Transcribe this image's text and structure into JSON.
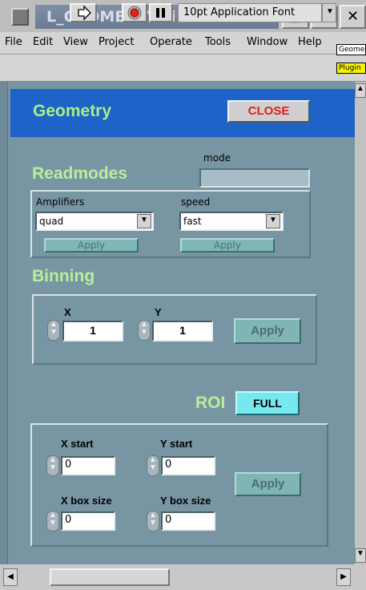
{
  "window": {
    "title": "L_GEOMETRY.vi Front Panel",
    "controls": {
      "minimize": "▣",
      "resize": "⇕",
      "close": "✕"
    }
  },
  "menu": [
    "File",
    "Edit",
    "View",
    "Project",
    "Operate",
    "Tools",
    "Window",
    "Help"
  ],
  "toolbar": {
    "font": "10pt Application Font",
    "side_tabs": [
      "Geome",
      "Plugin"
    ]
  },
  "panel": {
    "title": "Geometry",
    "close_label": "CLOSE",
    "mode_label": "mode",
    "mode_value": "",
    "readmodes_heading": "Readmodes",
    "amplifiers_label": "Amplifiers",
    "amplifiers_value": "quad",
    "speed_label": "speed",
    "speed_value": "fast",
    "apply_label": "Apply",
    "binning_heading": "Binning",
    "bin_x_label": "X",
    "bin_x_value": "1",
    "bin_y_label": "Y",
    "bin_y_value": "1",
    "roi_heading": "ROI",
    "full_label": "FULL",
    "x_start_label": "X start",
    "x_start_value": "0",
    "y_start_label": "Y start",
    "y_start_value": "0",
    "x_box_label": "X box size",
    "x_box_value": "0",
    "y_box_label": "Y box size",
    "y_box_value": "0"
  },
  "colors": {
    "panel_bg": "#7895a3",
    "header_bg": "#1f63c8",
    "heading_green": "#b9ee9a",
    "close_red": "#e0201a",
    "full_cyan": "#76e8ef"
  }
}
